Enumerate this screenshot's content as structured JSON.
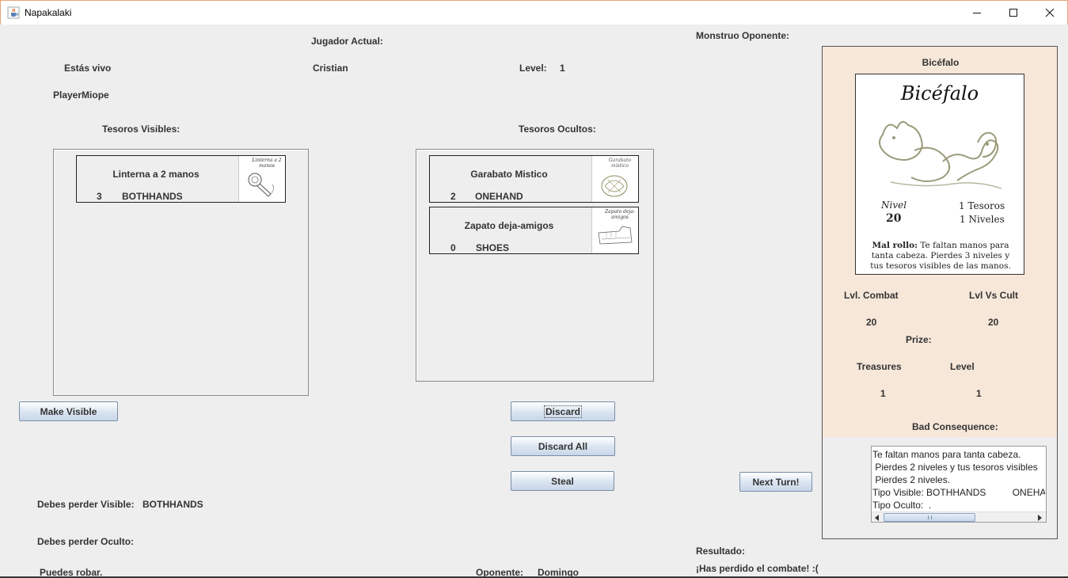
{
  "window": {
    "title": "Napakalaki"
  },
  "player": {
    "current_label": "Jugador Actual:",
    "status": "Estás vivo",
    "name": "Cristian",
    "level_label": "Level:",
    "level": "1",
    "type": "PlayerMiope",
    "visible_label": "Tesoros Visibles:",
    "hidden_label": "Tesoros Ocultos:"
  },
  "visible_treasures": [
    {
      "name": "Linterna a 2 manos",
      "bonus": "3",
      "type": "BOTHHANDS",
      "img_caption": "Linterna a 2 manos"
    }
  ],
  "hidden_treasures": [
    {
      "name": "Garabato Mistico",
      "bonus": "2",
      "type": "ONEHAND",
      "img_caption": "Garabato místico"
    },
    {
      "name": "Zapato deja-amigos",
      "bonus": "0",
      "type": "SHOES",
      "img_caption": "Zapato deja-amigos"
    }
  ],
  "buttons": {
    "make_visible": "Make Visible",
    "discard": "Discard",
    "discard_all": "Discard All",
    "steal": "Steal",
    "next_turn": "Next Turn!"
  },
  "pending": {
    "visible_label": "Debes perder Visible:",
    "visible_value": "BOTHHANDS",
    "hidden_label": "Debes perder Oculto:",
    "can_steal": "Puedes robar.",
    "opponent_label": "Oponente:",
    "opponent_name": "Domingo"
  },
  "monster": {
    "section_label": "Monstruo Oponente:",
    "name": "Bicéfalo",
    "card": {
      "title": "Bicéfalo",
      "level_word": "Nivel",
      "level": "20",
      "treasures": "1 Tesoros",
      "levels": "1 Niveles",
      "bad_title": "Mal rollo:",
      "bad_text": "Te faltan manos para tanta cabeza. Pierdes 3 niveles y tus tesoros visibles de las manos."
    },
    "combat_label": "Lvl. Combat",
    "combat_value": "20",
    "vs_cult_label": "Lvl Vs Cult",
    "vs_cult_value": "20",
    "prize_label": "Prize:",
    "treasures_label": "Treasures",
    "treasures_value": "1",
    "level_label": "Level",
    "level_value": "1",
    "bad_consequence_label": "Bad Consequence:",
    "bad_consequence_lines": [
      "Te faltan manos para tanta cabeza.",
      " Pierdes 2 niveles y tus tesoros visibles",
      " Pierdes 2 niveles.",
      "Tipo Visible: BOTHHANDS          ONEHAND",
      "Tipo Oculto:  ."
    ]
  },
  "result": {
    "label": "Resultado:",
    "text": "¡Has perdido el combate! :("
  },
  "icons": {
    "app": "java-cup-icon",
    "minimize": "minimize-icon",
    "maximize": "maximize-icon",
    "close": "close-icon"
  }
}
